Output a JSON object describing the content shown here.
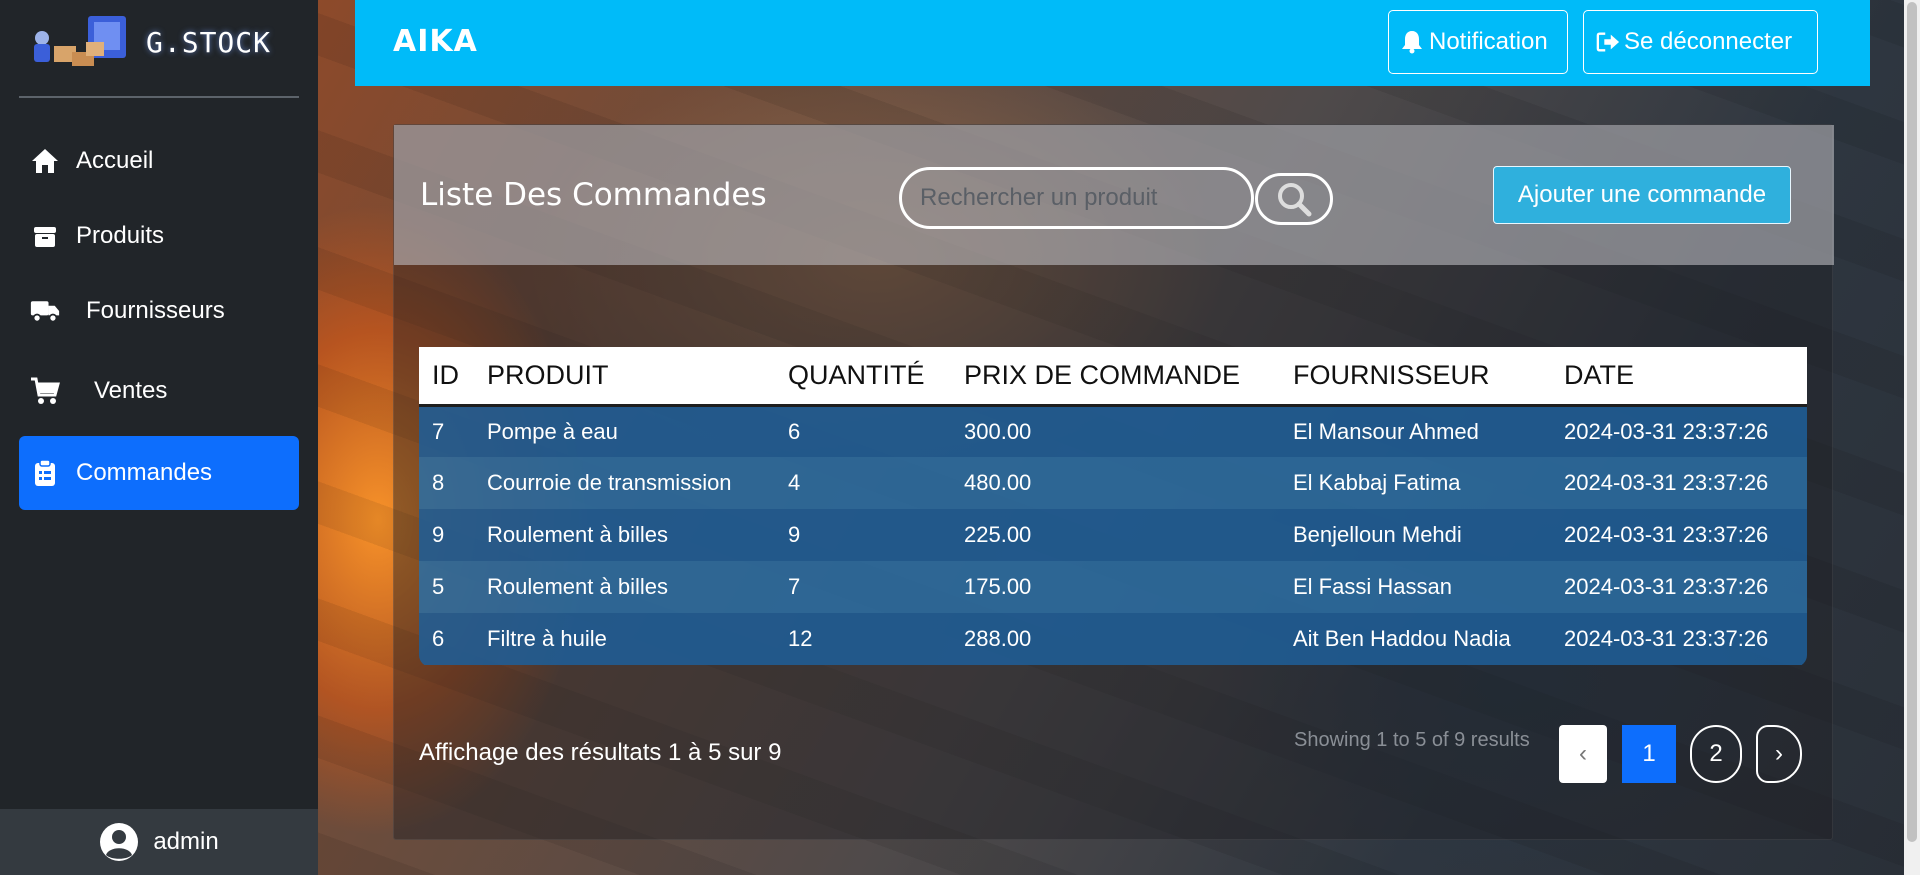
{
  "brand": {
    "name": "G.STOCK"
  },
  "sidebar": {
    "items": [
      {
        "label": "Accueil",
        "icon": "home-icon"
      },
      {
        "label": "Produits",
        "icon": "box-icon"
      },
      {
        "label": "Fournisseurs",
        "icon": "truck-icon"
      },
      {
        "label": "Ventes",
        "icon": "cart-icon"
      },
      {
        "label": "Commandes",
        "icon": "clipboard-icon",
        "active": true
      }
    ],
    "user": "admin"
  },
  "topbar": {
    "title": "AIKA",
    "notification_label": "Notification",
    "logout_label": "Se déconnecter"
  },
  "panel": {
    "title": "Liste Des Commandes",
    "search_placeholder": "Rechercher un produit",
    "add_label": "Ajouter une commande"
  },
  "table": {
    "headers": [
      "ID",
      "PRODUIT",
      "QUANTITÉ",
      "PRIX DE COMMANDE",
      "FOURNISSEUR",
      "DATE"
    ],
    "rows": [
      [
        "7",
        "Pompe à eau",
        "6",
        "300.00",
        "El Mansour Ahmed",
        "2024-03-31 23:37:26"
      ],
      [
        "8",
        "Courroie de transmission",
        "4",
        "480.00",
        "El Kabbaj Fatima",
        "2024-03-31 23:37:26"
      ],
      [
        "9",
        "Roulement à billes",
        "9",
        "225.00",
        "Benjelloun Mehdi",
        "2024-03-31 23:37:26"
      ],
      [
        "5",
        "Roulement à billes",
        "7",
        "175.00",
        "El Fassi Hassan",
        "2024-03-31 23:37:26"
      ],
      [
        "6",
        "Filtre à huile",
        "12",
        "288.00",
        "Ait Ben Haddou Nadia",
        "2024-03-31 23:37:26"
      ]
    ]
  },
  "footer": {
    "results_text": "Affichage des résultats 1 à 5 sur 9",
    "showing_text": "Showing 1 to 5 of 9 results",
    "pagination": {
      "prev": "‹",
      "pages": [
        "1",
        "2"
      ],
      "current": "1",
      "next": "›"
    }
  },
  "colors": {
    "sidebar_bg": "#212529",
    "active_nav": "#0d6efd",
    "topbar_bg": "#00bbf9",
    "add_button": "#2fb0dd"
  }
}
